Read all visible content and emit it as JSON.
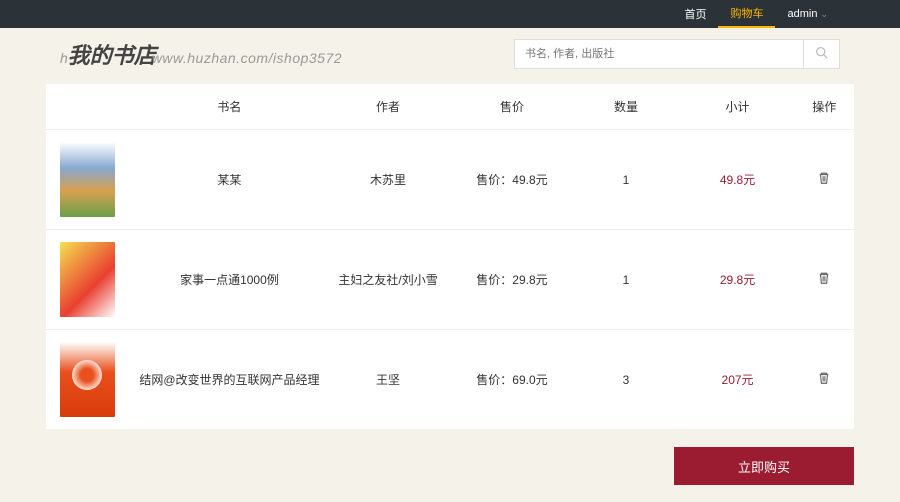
{
  "nav": {
    "home": "首页",
    "cart": "购物车",
    "user": "admin"
  },
  "logo_text": "我的书店",
  "watermark_prefix": "h",
  "watermark_suffix": "www.huzhan.com/ishop3572",
  "search": {
    "placeholder": "书名, 作者, 出版社"
  },
  "table_headers": {
    "name": "书名",
    "author": "作者",
    "price": "售价",
    "quantity": "数量",
    "subtotal": "小计",
    "action": "操作"
  },
  "price_prefix": "售价：",
  "currency_suffix": "元",
  "cart_items": [
    {
      "name": "某某",
      "author": "木苏里",
      "price": "49.8",
      "quantity": "1",
      "subtotal": "49.8"
    },
    {
      "name": "家事一点通1000例",
      "author": "主妇之友社/刘小雪",
      "price": "29.8",
      "quantity": "1",
      "subtotal": "29.8"
    },
    {
      "name": "结网@改变世界的互联网产品经理",
      "author": "王坚",
      "price": "69.0",
      "quantity": "3",
      "subtotal": "207"
    }
  ],
  "buy_now": "立即购买"
}
